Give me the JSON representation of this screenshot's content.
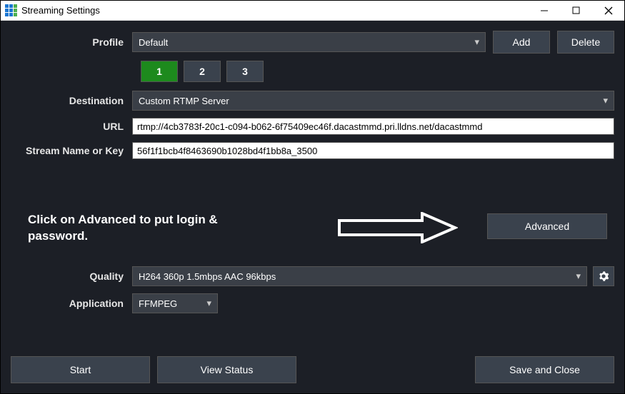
{
  "window": {
    "title": "Streaming Settings"
  },
  "profile": {
    "label": "Profile",
    "selected": "Default",
    "add_label": "Add",
    "delete_label": "Delete"
  },
  "tabs": [
    "1",
    "2",
    "3"
  ],
  "destination": {
    "label": "Destination",
    "selected": "Custom RTMP Server"
  },
  "url": {
    "label": "URL",
    "value": "rtmp://4cb3783f-20c1-c094-b062-6f75409ec46f.dacastmmd.pri.lldns.net/dacastmmd"
  },
  "stream_key": {
    "label": "Stream Name or Key",
    "value": "56f1f1bcb4f8463690b1028bd4f1bb8a_3500"
  },
  "annotation": {
    "text": "Click on Advanced to put login & password."
  },
  "advanced": {
    "label": "Advanced"
  },
  "quality": {
    "label": "Quality",
    "selected": "H264 360p 1.5mbps AAC 96kbps"
  },
  "application": {
    "label": "Application",
    "selected": "FFMPEG"
  },
  "footer": {
    "start": "Start",
    "view_status": "View Status",
    "save_close": "Save and Close"
  }
}
